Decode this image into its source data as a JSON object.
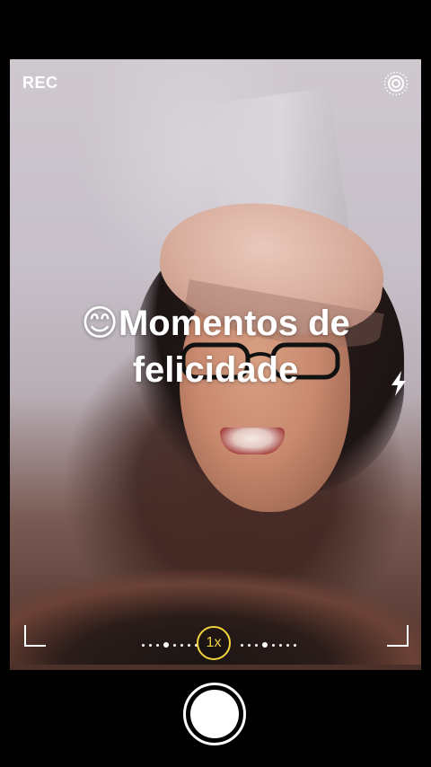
{
  "camera": {
    "rec_label": "REC",
    "zoom_label": "1x",
    "live_icon": "live-photo-icon",
    "flash_icon": "flash-icon",
    "accent_color": "#f2d33b"
  },
  "caption": {
    "emoji": "😊",
    "line1": "Momentos de",
    "line2": "felicidade"
  }
}
